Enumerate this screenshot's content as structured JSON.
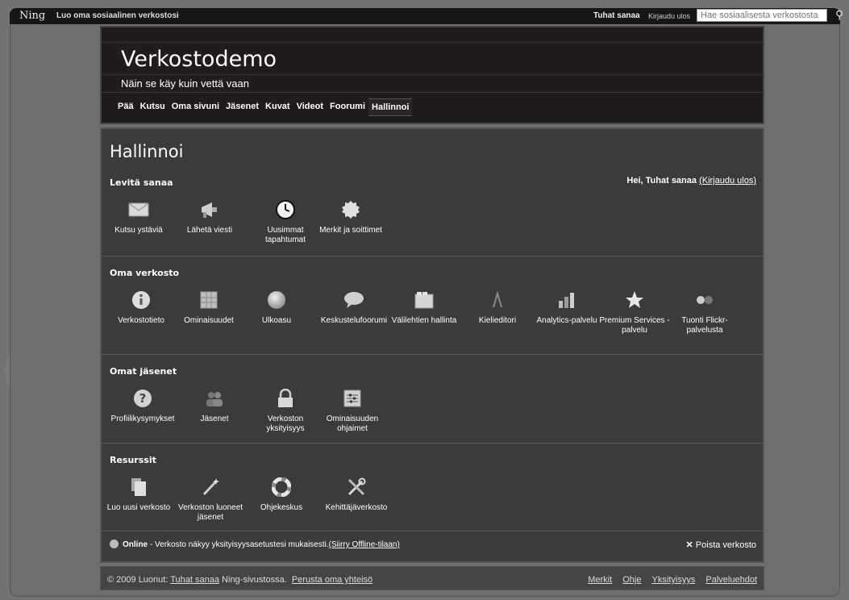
{
  "topbar": {
    "logo": "Ning",
    "create_link": "Luo oma sosiaalinen verkostosi",
    "user": "Tuhat sanaa",
    "logout": "Kirjaudu ulos",
    "search_placeholder": "Hae sosiaalisesta verkostosta"
  },
  "header": {
    "title": "Verkostodemo",
    "tagline": "Näin se käy kuin vettä vaan",
    "nav": [
      "Pää",
      "Kutsu",
      "Oma sivuni",
      "Jäsenet",
      "Kuvat",
      "Videot",
      "Foorumi",
      "Hallinnoi"
    ]
  },
  "main": {
    "title": "Hallinnoi",
    "greeting": "Hei, Tuhat sanaa",
    "greeting_logout": "(Kirjaudu ulos)",
    "sections": {
      "spread": {
        "title": "Levitä sanaa",
        "tiles": [
          {
            "label": "Kutsu ystäviä",
            "icon": "envelope-icon"
          },
          {
            "label": "Lähetä viesti",
            "icon": "megaphone-icon"
          },
          {
            "label": "Uusimmat tapahtumat",
            "icon": "clock-icon"
          },
          {
            "label": "Merkit ja soittimet",
            "icon": "badge-icon"
          }
        ]
      },
      "network": {
        "title": "Oma verkosto",
        "tiles": [
          {
            "label": "Verkostotieto",
            "icon": "info-icon"
          },
          {
            "label": "Ominaisuudet",
            "icon": "grid-icon"
          },
          {
            "label": "Ulkoasu",
            "icon": "sphere-icon"
          },
          {
            "label": "Keskustelufoorumi",
            "icon": "speech-bubble-icon"
          },
          {
            "label": "Välilehtien hallinta",
            "icon": "tabs-icon"
          },
          {
            "label": "Kielieditori",
            "icon": "language-icon"
          },
          {
            "label": "Analytics-palvelu",
            "icon": "bar-chart-icon"
          },
          {
            "label": "Premium Services -palvelu",
            "icon": "star-icon"
          },
          {
            "label": "Tuonti Flickr-palvelusta",
            "icon": "flickr-icon"
          }
        ]
      },
      "members": {
        "title": "Omat jäsenet",
        "tiles": [
          {
            "label": "Profiilikysymykset",
            "icon": "question-icon"
          },
          {
            "label": "Jäsenet",
            "icon": "people-icon"
          },
          {
            "label": "Verkoston yksityisyys",
            "icon": "lock-icon"
          },
          {
            "label": "Ominaisuuden ohjaimet",
            "icon": "sliders-icon"
          }
        ]
      },
      "resources": {
        "title": "Resurssit",
        "tiles": [
          {
            "label": "Luo uusi verkosto",
            "icon": "documents-icon"
          },
          {
            "label": "Verkoston luoneet jäsenet",
            "icon": "magic-wand-icon"
          },
          {
            "label": "Ohjekeskus",
            "icon": "lifebuoy-icon"
          },
          {
            "label": "Kehittäjäverkosto",
            "icon": "tools-icon"
          }
        ]
      }
    },
    "status": {
      "label": "Online",
      "text": " - Verkosto näkyy yksityisyysasetustesi mukaisesti.",
      "link": "(Siirry Offline-tilaan)"
    },
    "delete": "Poista verkosto"
  },
  "footer": {
    "copyright": "© 2009   Luonut: ",
    "creator": "Tuhat sanaa",
    "suffix": " Ning-sivustossa.  ",
    "start_link": "Perusta oma yhteisö",
    "links": [
      "Merkit",
      "Ohje",
      "Yksityisyys",
      "Palveluehdot"
    ]
  }
}
